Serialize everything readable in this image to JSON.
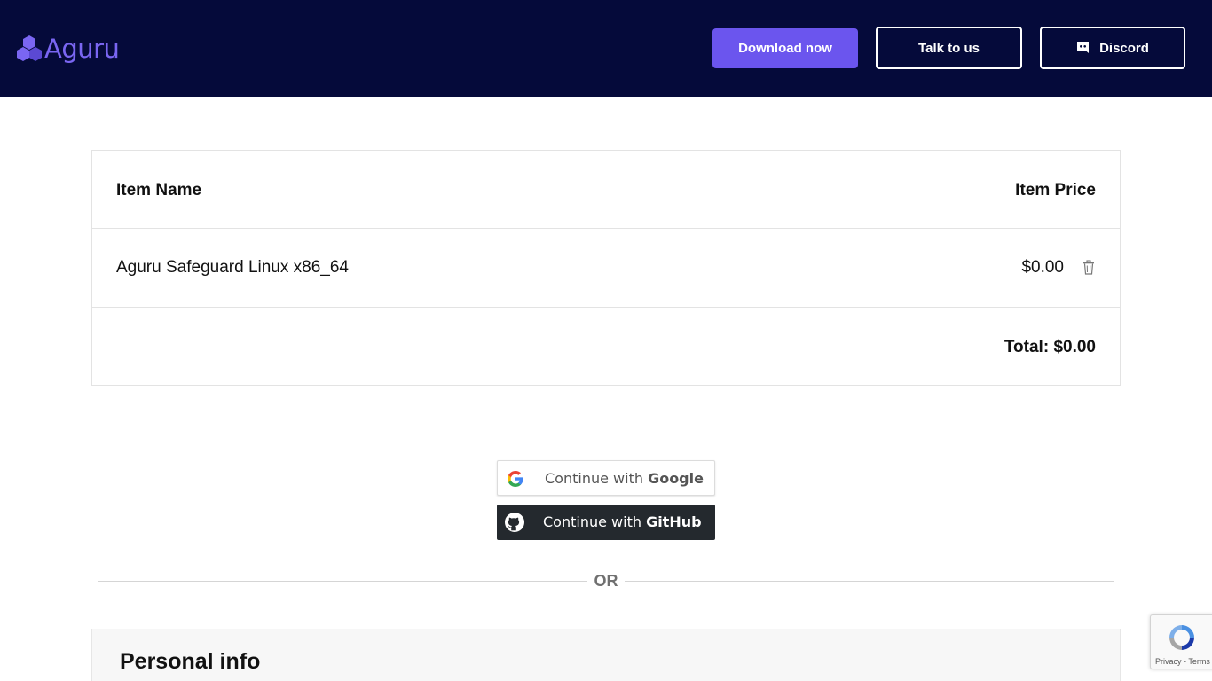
{
  "header": {
    "logo_text": "Aguru",
    "download_label": "Download now",
    "talk_label": "Talk to us",
    "discord_label": "Discord",
    "colors": {
      "background": "#050a3a",
      "accent": "#6b55ee",
      "logo": "#7a66f2"
    }
  },
  "cart": {
    "col_name": "Item Name",
    "col_price": "Item Price",
    "items": [
      {
        "name": "Aguru Safeguard Linux x86_64",
        "price": "$0.00"
      }
    ],
    "total": "Total: $0.00"
  },
  "auth": {
    "google_prefix": "Continue with ",
    "google_brand": "Google",
    "github_prefix": "Continue with ",
    "github_brand": "GitHub",
    "or_label": "OR"
  },
  "personal": {
    "title": "Personal info"
  },
  "recaptcha": {
    "privacy": "Privacy",
    "separator": " - ",
    "terms": "Terms"
  }
}
